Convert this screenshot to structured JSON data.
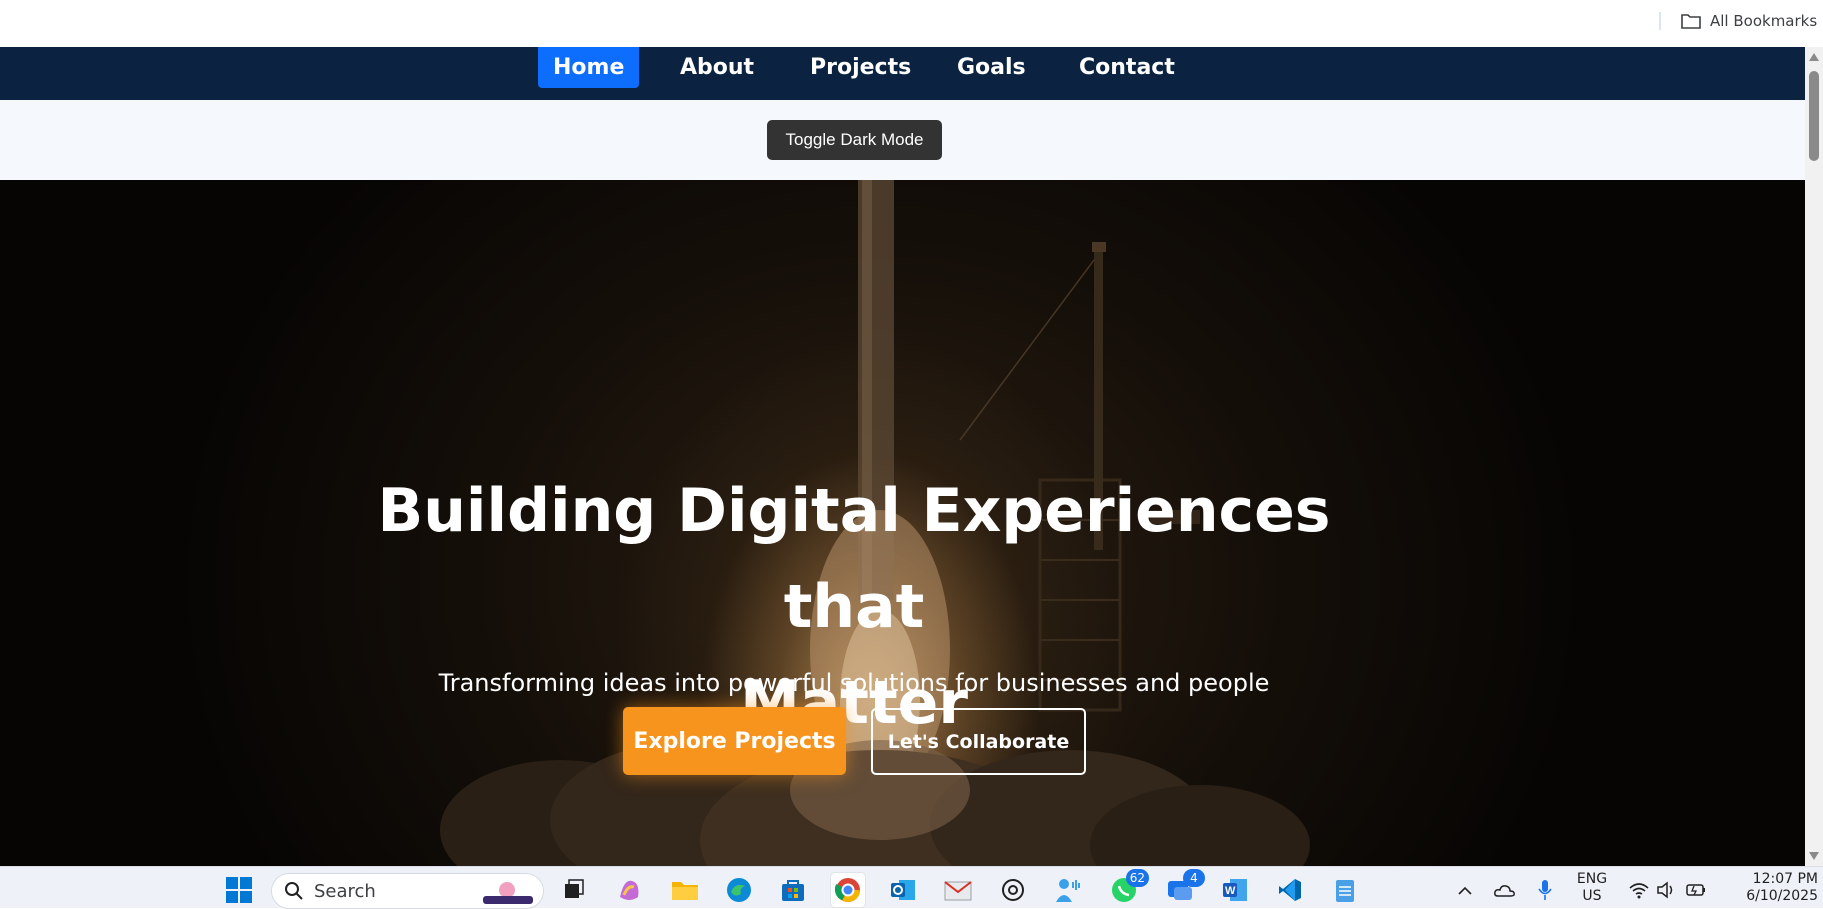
{
  "browser": {
    "all_bookmarks_label": "All Bookmarks"
  },
  "nav": {
    "items": [
      {
        "label": "Home",
        "active": true
      },
      {
        "label": "About",
        "active": false
      },
      {
        "label": "Projects",
        "active": false
      },
      {
        "label": "Goals",
        "active": false
      },
      {
        "label": "Contact",
        "active": false
      }
    ]
  },
  "toggle": {
    "label": "Toggle Dark Mode"
  },
  "hero": {
    "title_line1": "Building Digital Experiences that",
    "title_line2": "Matter",
    "subtitle": "Transforming ideas into powerful solutions for businesses and people",
    "primary_button": "Explore Projects",
    "secondary_button": "Let's Collaborate"
  },
  "taskbar": {
    "search_placeholder": "Search",
    "whatsapp_badge": "62",
    "messages_badge": "4",
    "language": "ENG",
    "region": "US",
    "time": "12:07 PM",
    "date": "6/10/2025"
  },
  "colors": {
    "nav_bg": "#0b2340",
    "nav_active": "#0d6efd",
    "accent_orange": "#f7941d",
    "toggle_bg": "#333333"
  }
}
